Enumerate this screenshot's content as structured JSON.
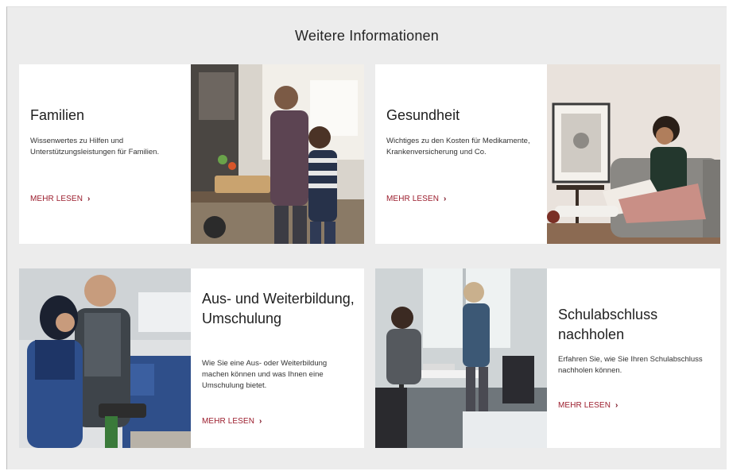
{
  "section": {
    "title": "Weitere Informationen"
  },
  "cards": [
    {
      "title": "Familien",
      "text": "Wissenwertes zu Hilfen und Unterstützungsleistungen für Familien.",
      "link": "MEHR LESEN",
      "image_icon": "photo-family-cooking"
    },
    {
      "title": "Gesundheit",
      "text": "Wichtiges zu den Kosten für Medikamente, Krankenversicherung und Co.",
      "link": "MEHR LESEN",
      "image_icon": "photo-woman-armchair"
    },
    {
      "title": "Aus- und Weiterbildung, Umschulung",
      "text": "Wie Sie eine Aus- oder Weiterbildung machen können und was Ihnen eine Umschulung bietet.",
      "link": "MEHR LESEN",
      "image_icon": "photo-workshop-training"
    },
    {
      "title": "Schulabschluss nachholen",
      "text": "Erfahren Sie, wie Sie Ihren Schulabschluss nachholen können.",
      "link": "MEHR LESEN",
      "image_icon": "photo-classroom"
    }
  ],
  "colors": {
    "background": "#ececec",
    "card": "#ffffff",
    "link": "#9b1c2c"
  }
}
